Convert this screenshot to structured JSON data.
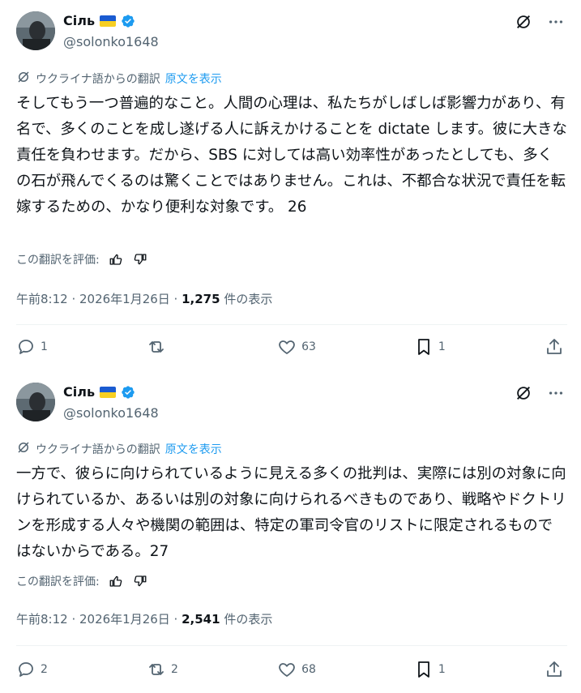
{
  "posts": [
    {
      "author": {
        "name": "Сіль",
        "handle": "@solonko1648"
      },
      "translated_from": "ウクライナ語からの翻訳",
      "show_original": "原文を表示",
      "text": "そしてもう一つ普遍的なこと。人間の心理は、私たちがしばしば影響力があり、有名で、多くのことを成し遂げる人に訴えかけることを dictate します。彼に大きな責任を負わせます。だから、SBS に対しては高い効率性があったとしても、多くの石が飛んでくるのは驚くことではありません。これは、不都合な状況で責任を転嫁するための、かなり便利な対象です。 26",
      "rate_label": "この翻訳を評価:",
      "timestamp": "午前8:12 · 2026年1月26日 · ",
      "views_count": "1,275",
      "views_label": " 件の表示",
      "stats": {
        "replies": "1",
        "reposts": "",
        "likes": "63",
        "bookmarks": "1"
      }
    },
    {
      "author": {
        "name": "Сіль",
        "handle": "@solonko1648"
      },
      "translated_from": "ウクライナ語からの翻訳",
      "show_original": "原文を表示",
      "text": "一方で、彼らに向けられているように見える多くの批判は、実際には別の対象に向けられているか、あるいは別の対象に向けられるべきものであり、戦略やドクトリンを形成する人々や機関の範囲は、特定の軍司令官のリストに限定されるものではないからである。27",
      "rate_label": "この翻訳を評価:",
      "timestamp": "午前8:12 · 2026年1月26日 · ",
      "views_count": "2,541",
      "views_label": " 件の表示",
      "stats": {
        "replies": "2",
        "reposts": "2",
        "likes": "68",
        "bookmarks": "1"
      }
    }
  ],
  "colors": {
    "accent": "#1d9bf0",
    "muted": "#536471",
    "text": "#0f1419",
    "divider": "#eff3f4"
  },
  "icons": [
    "grok-icon",
    "more-icon",
    "translate-icon",
    "thumbs-up-icon",
    "thumbs-down-icon",
    "reply-icon",
    "repost-icon",
    "like-icon",
    "bookmark-icon",
    "share-icon",
    "verified-badge-icon"
  ]
}
